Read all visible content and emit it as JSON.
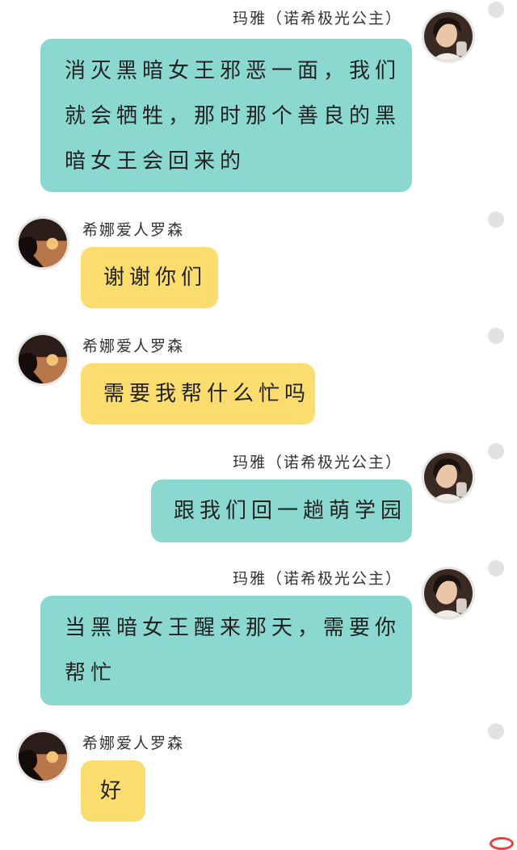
{
  "messages": [
    {
      "sender": "玛雅（诺希极光公主）",
      "side": "right",
      "color": "#8ad8cf",
      "lines": [
        "消灭黑暗女王邪恶一面，我们",
        "就会牺牲，那时那个善良的黑",
        "暗女王会回来的"
      ]
    },
    {
      "sender": "希娜爱人罗森",
      "side": "left",
      "color": "#fbdc6f",
      "lines": [
        "谢谢你们"
      ]
    },
    {
      "sender": "希娜爱人罗森",
      "side": "left",
      "color": "#fbdc6f",
      "lines": [
        "需要我帮什么忙吗"
      ]
    },
    {
      "sender": "玛雅（诺希极光公主）",
      "side": "right",
      "color": "#8ad8cf",
      "lines": [
        "跟我们回一趟萌学园"
      ]
    },
    {
      "sender": "玛雅（诺希极光公主）",
      "side": "right",
      "color": "#8ad8cf",
      "lines": [
        "当黑暗女王醒来那天，需要你",
        "帮忙"
      ]
    },
    {
      "sender": "希娜爱人罗森",
      "side": "left",
      "color": "#fbdc6f",
      "lines": [
        "好"
      ]
    }
  ]
}
